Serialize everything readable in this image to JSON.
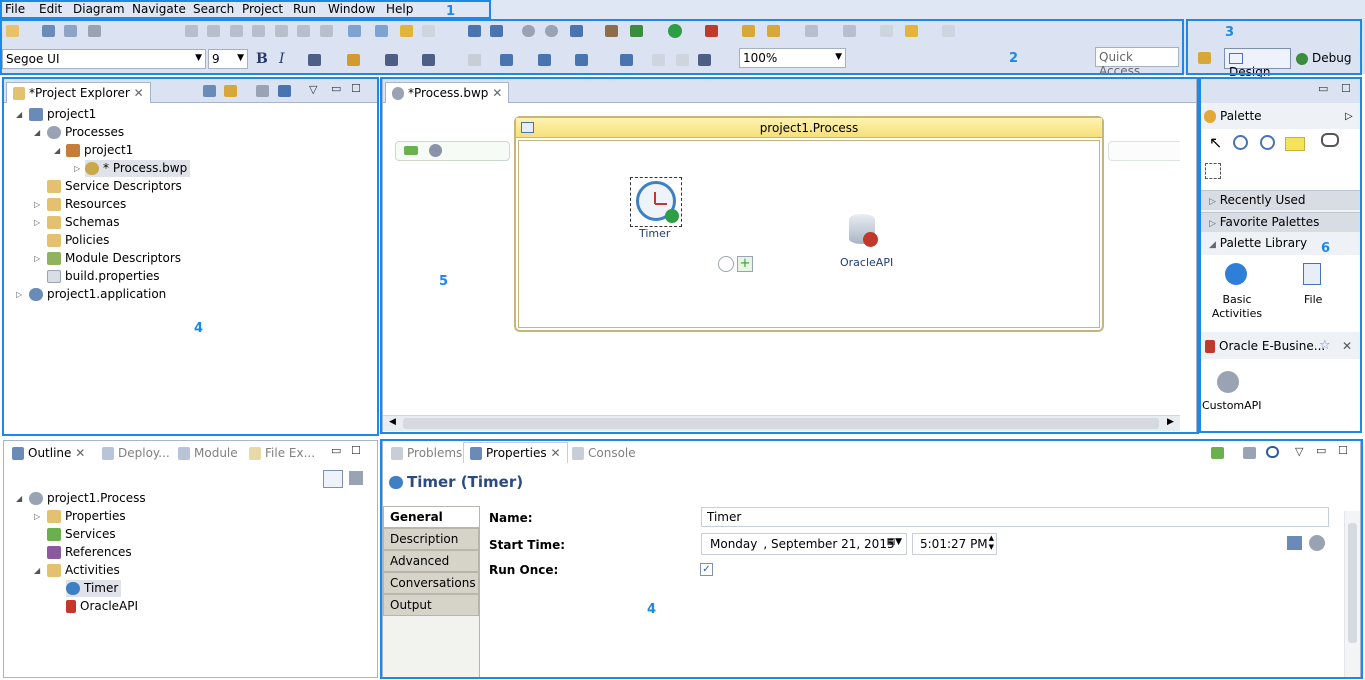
{
  "menu": [
    "File",
    "Edit",
    "Diagram",
    "Navigate",
    "Search",
    "Project",
    "Run",
    "Window",
    "Help"
  ],
  "toolbar": {
    "font_name": "Segoe UI",
    "font_size": "9",
    "bold": "B",
    "italic": "I",
    "zoom": "100%",
    "quick_access": "Quick Access"
  },
  "perspectives": {
    "design": "Design",
    "debug": "Debug"
  },
  "project_explorer": {
    "title": "*Project Explorer",
    "items": [
      "project1",
      "Processes",
      "project1",
      "* Process.bwp",
      "Service Descriptors",
      "Resources",
      "Schemas",
      "Policies",
      "Module Descriptors",
      "build.properties",
      "project1.application"
    ]
  },
  "editor": {
    "tab": "*Process.bwp",
    "process_title": "project1.Process",
    "timer_label": "Timer",
    "oracle_label": "OracleAPI"
  },
  "palette": {
    "title": "Palette",
    "recently_used": "Recently Used",
    "favorite": "Favorite Palettes",
    "library": "Palette Library",
    "basic_line1": "Basic",
    "basic_line2": "Activities",
    "file": "File",
    "oracle_group": "Oracle E-Busine...",
    "custom_api": "CustomAPI"
  },
  "outline": {
    "tabs": [
      "Outline",
      "Deploy...",
      "Module",
      "File Ex..."
    ],
    "items": [
      "project1.Process",
      "Properties",
      "Services",
      "References",
      "Activities",
      "Timer",
      "OracleAPI"
    ]
  },
  "properties": {
    "tabs": [
      "Problems",
      "Properties",
      "Console"
    ],
    "heading": "Timer (Timer)",
    "side_tabs": [
      "General",
      "Description",
      "Advanced",
      "Conversations",
      "Output"
    ],
    "name_label": "Name:",
    "name_value": "Timer",
    "start_label": "Start Time:",
    "date_day": "Monday",
    "date_rest": ", September 21, 2015",
    "time_value": "5:01:27 PM",
    "run_once_label": "Run Once:"
  },
  "annotations": [
    "1",
    "2",
    "3",
    "4",
    "5",
    "6",
    "4",
    "4"
  ]
}
